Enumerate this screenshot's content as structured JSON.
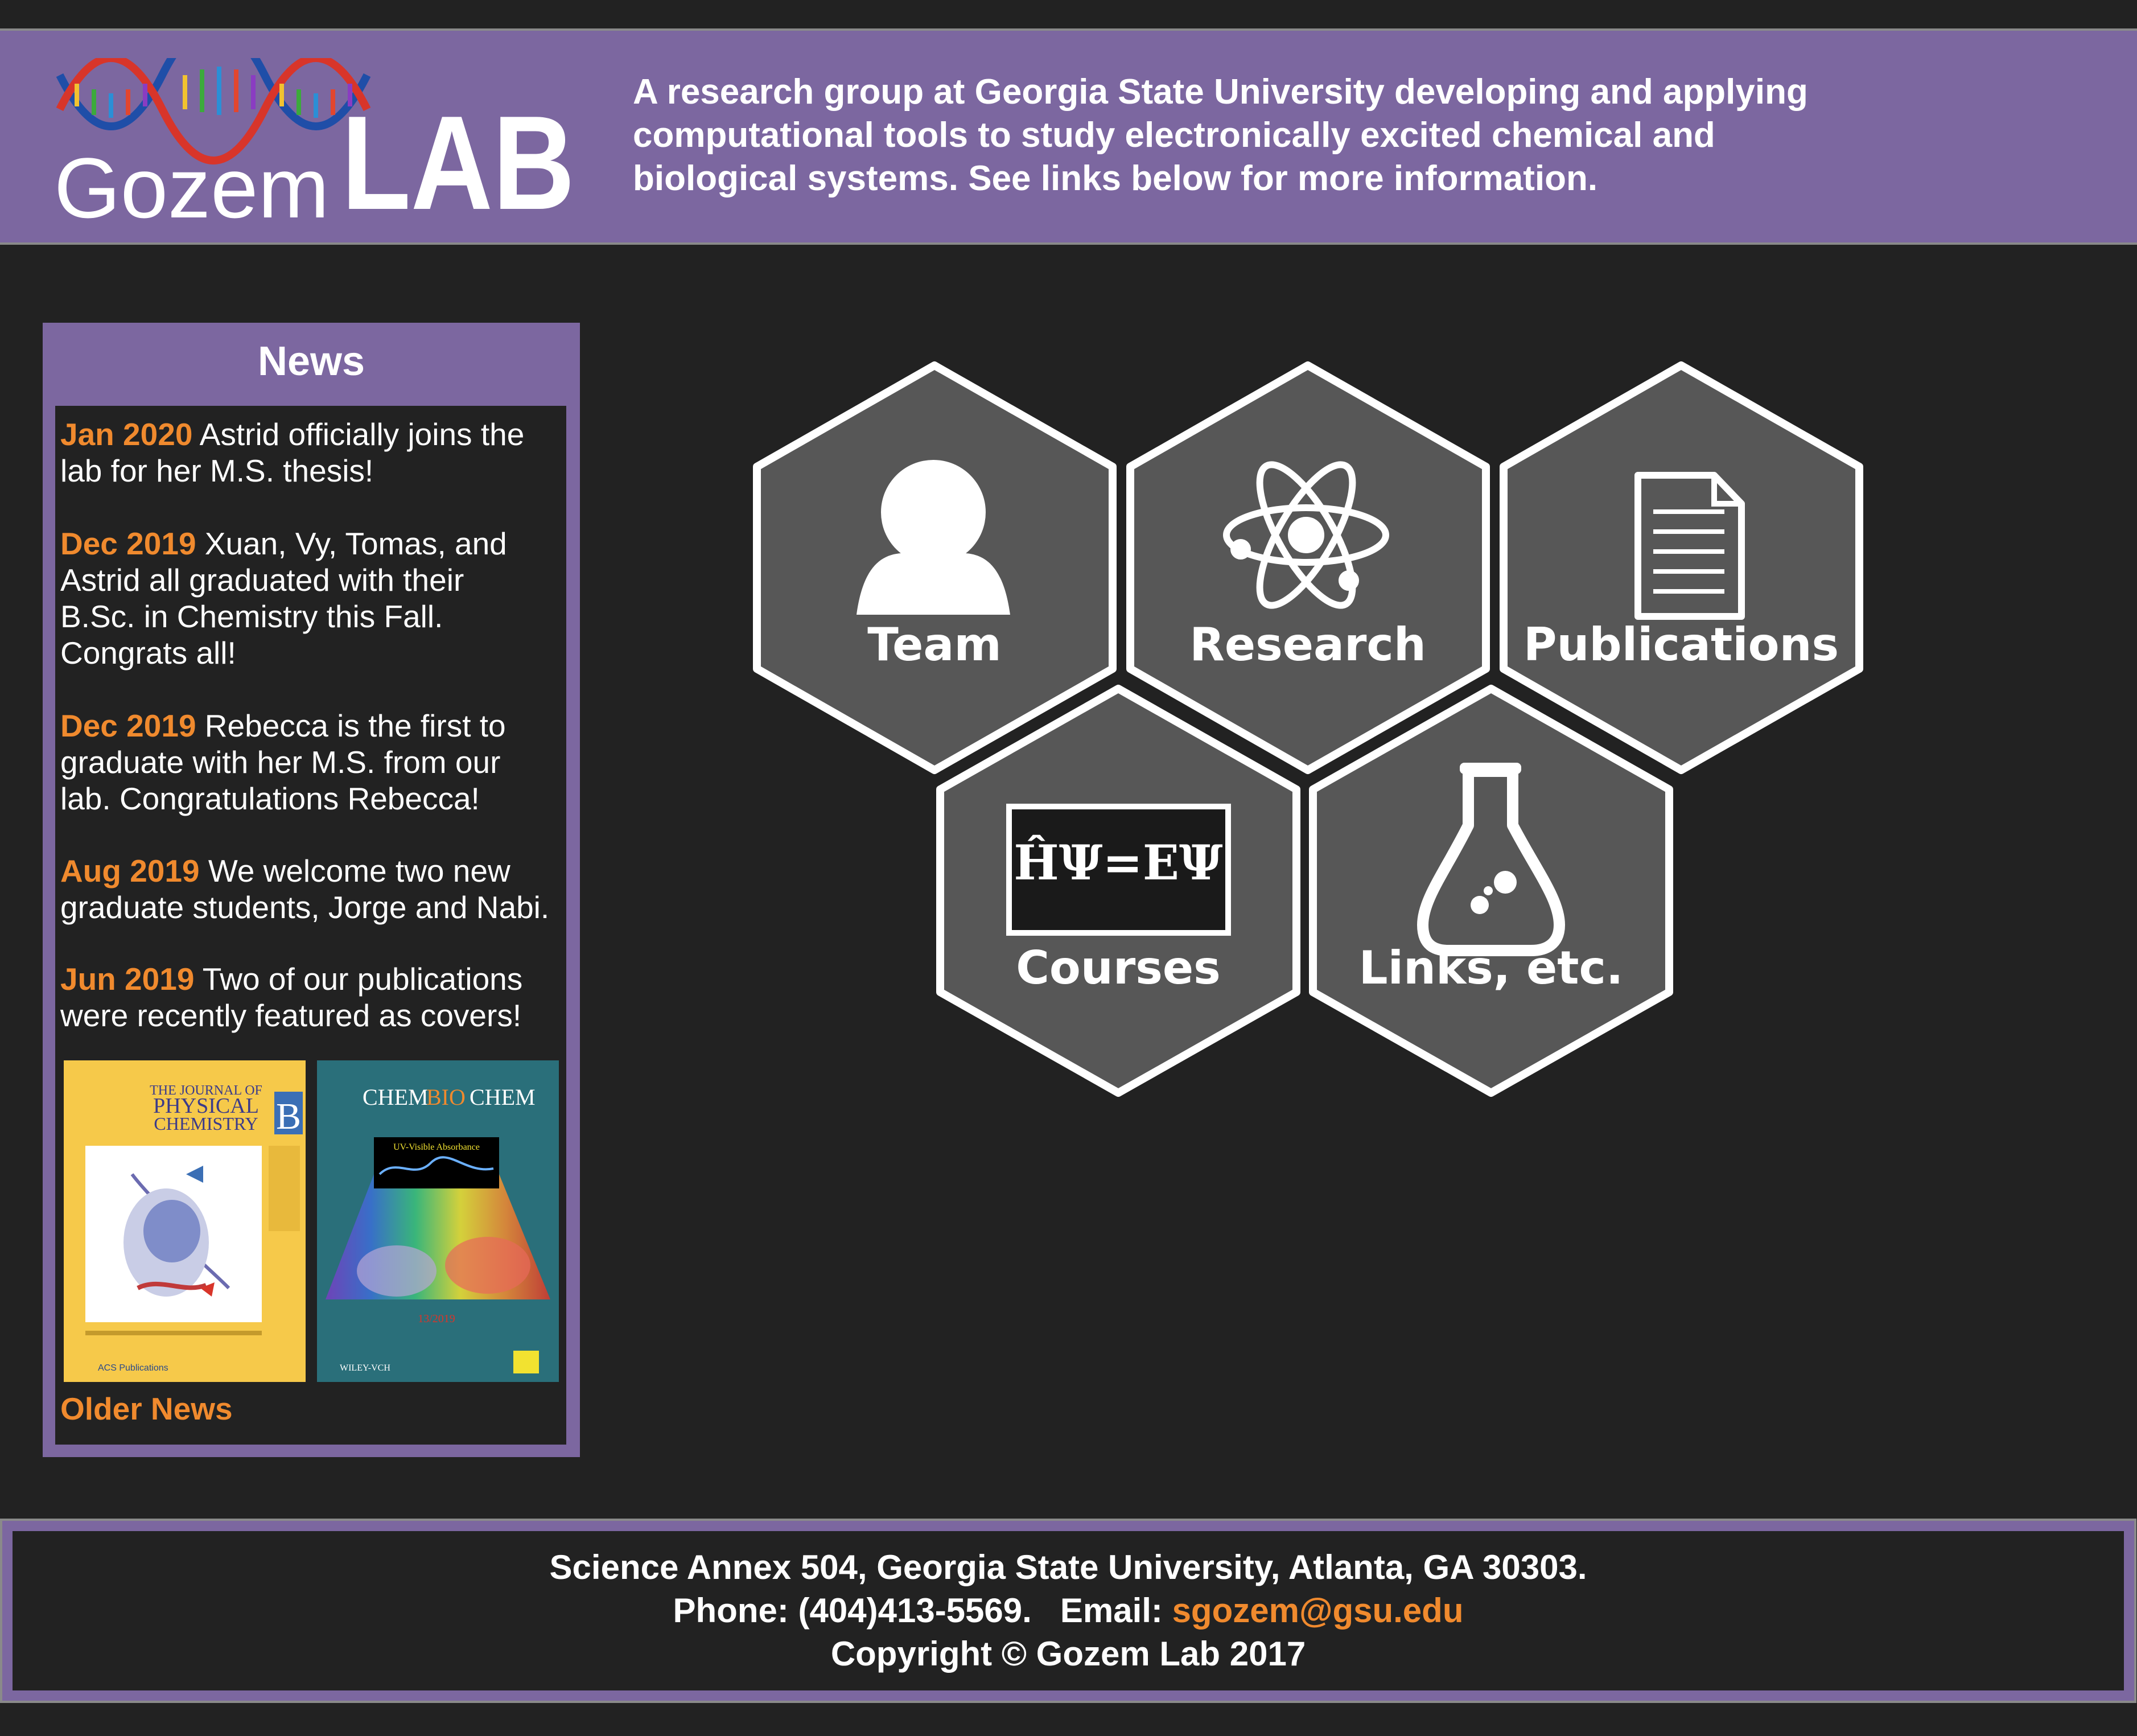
{
  "header": {
    "logo_text_primary": "Gozem",
    "logo_text_secondary": "LAB",
    "tagline_lines": [
      "A research group at Georgia State University developing and applying",
      "computational tools to study electronically excited chemical and",
      "biological systems. See links below for more information."
    ]
  },
  "news": {
    "title": "News",
    "items": [
      {
        "date": "Jan 2020",
        "lines": [
          " Astrid officially joins the",
          "lab for her M.S. thesis!"
        ]
      },
      {
        "date": "Dec 2019",
        "lines": [
          " Xuan, Vy, Tomas, and",
          "Astrid all graduated with their",
          "B.Sc. in Chemistry this Fall.",
          "Congrats all!"
        ]
      },
      {
        "date": "Dec 2019",
        "lines": [
          " Rebecca is the first to",
          "graduate with her M.S. from our",
          "lab. Congratulations Rebecca!"
        ]
      },
      {
        "date": "Aug 2019",
        "lines": [
          "  We welcome two new",
          "graduate students, Jorge and Nabi."
        ]
      },
      {
        "date": "Jun 2019",
        "lines": [
          "  Two of our publications",
          "were recently featured as covers!"
        ]
      }
    ],
    "covers": [
      {
        "journal_line1": "THE JOURNAL OF",
        "journal_line2": "PHYSICAL",
        "journal_line3": "CHEMISTRY",
        "journal_letter": "B",
        "footer": "ACS Publications"
      },
      {
        "journal_part1": "CHEM",
        "journal_part2": "BIO",
        "journal_part3": "CHEM",
        "subtitle": "UV-Visible Absorbance",
        "footer": "WILEY-VCH",
        "issue": "13/2019"
      }
    ],
    "older_news_label": "Older News"
  },
  "tiles": {
    "team": "Team",
    "research": "Research",
    "publications": "Publications",
    "courses": "Courses",
    "courses_equation": "ĤΨ=EΨ",
    "links": "Links, etc."
  },
  "footer": {
    "address": "Science Annex 504, Georgia State University, Atlanta, GA 30303.",
    "phone_label": "Phone: (404)413-5569.   Email: ",
    "email": "sgozem@gsu.edu",
    "copyright": "Copyright © Gozem Lab 2017"
  },
  "colors": {
    "accent_purple": "#7c67a0",
    "accent_orange": "#f08a2e",
    "background": "#222222",
    "hex_fill": "#575757"
  }
}
